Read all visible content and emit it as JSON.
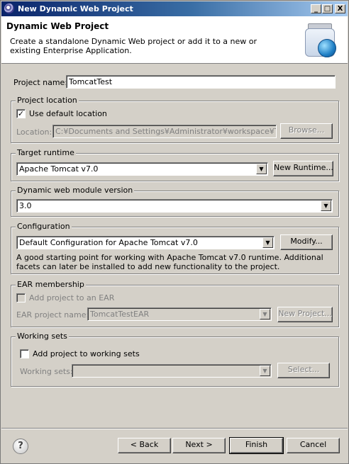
{
  "window": {
    "title": "New Dynamic Web Project",
    "controls": {
      "minimize": "_",
      "maximize": "□",
      "close": "X"
    }
  },
  "header": {
    "title": "Dynamic Web Project",
    "description": "Create a standalone Dynamic Web project or add it to a new or existing Enterprise Application."
  },
  "project_name": {
    "label": "Project name:",
    "value": "TomcatTest"
  },
  "project_location": {
    "group_label": "Project location",
    "use_default_label": "Use default location",
    "use_default_checked": true,
    "location_label": "Location:",
    "location_value": "C:¥Documents and Settings¥Administrator¥workspace¥Tomc",
    "browse_label": "Browse..."
  },
  "target_runtime": {
    "group_label": "Target runtime",
    "value": "Apache Tomcat v7.0",
    "new_runtime_label": "New Runtime..."
  },
  "module_version": {
    "group_label": "Dynamic web module version",
    "value": "3.0"
  },
  "configuration": {
    "group_label": "Configuration",
    "value": "Default Configuration for Apache Tomcat v7.0",
    "modify_label": "Modify...",
    "description": "A good starting point for working with Apache Tomcat v7.0 runtime. Additional facets can later be installed to add new functionality to the project."
  },
  "ear_membership": {
    "group_label": "EAR membership",
    "add_label": "Add project to an EAR",
    "add_checked": false,
    "ear_name_label": "EAR project name:",
    "ear_name_value": "TomcatTestEAR",
    "new_project_label": "New Project..."
  },
  "working_sets": {
    "group_label": "Working sets",
    "add_label": "Add project to working sets",
    "add_checked": false,
    "sets_label": "Working sets:",
    "sets_value": "",
    "select_label": "Select..."
  },
  "footer": {
    "help_label": "?",
    "back_label": "< Back",
    "next_label": "Next >",
    "finish_label": "Finish",
    "cancel_label": "Cancel"
  }
}
